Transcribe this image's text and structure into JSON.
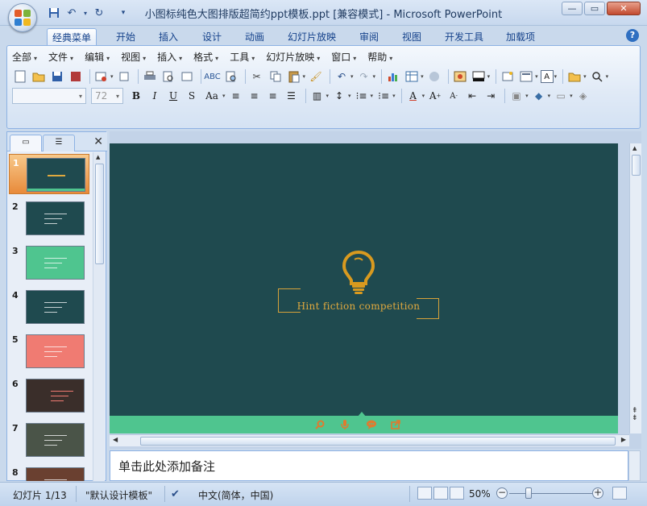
{
  "window": {
    "title": "小图标纯色大图排版超简约ppt模板.ppt [兼容模式] - Microsoft PowerPoint"
  },
  "ribbon_tabs": [
    "经典菜单",
    "开始",
    "插入",
    "设计",
    "动画",
    "幻灯片放映",
    "审阅",
    "视图",
    "开发工具",
    "加载项"
  ],
  "menu": [
    "全部",
    "文件",
    "编辑",
    "视图",
    "插入",
    "格式",
    "工具",
    "幻灯片放映",
    "窗口",
    "帮助"
  ],
  "format_bar": {
    "font_name": "",
    "font_size": "72"
  },
  "slides_panel": {
    "numbers": [
      "1",
      "2",
      "3",
      "4",
      "5",
      "6",
      "7",
      "8"
    ],
    "selected": 1,
    "thumb_colors": [
      "#1f4a4f",
      "#1f4a4f",
      "#4fc58f",
      "#1f4a4f",
      "#f07b72",
      "#3a2e2a",
      "#4a5448",
      "#6a4030"
    ]
  },
  "slide": {
    "title": "Hint fiction competition",
    "colors": {
      "background": "#1f4a4f",
      "accent": "#e0a93e",
      "bar": "#4fc58f",
      "icons": "#e07a2e"
    },
    "bottom_icons": [
      "search-icon",
      "microphone-icon",
      "chat-icon",
      "share-icon"
    ]
  },
  "notes": {
    "placeholder": "单击此处添加备注"
  },
  "status": {
    "slide_info": "幻灯片 1/13",
    "theme": "\"默认设计模板\"",
    "language": "中文(简体，中国)",
    "zoom": "50%"
  }
}
